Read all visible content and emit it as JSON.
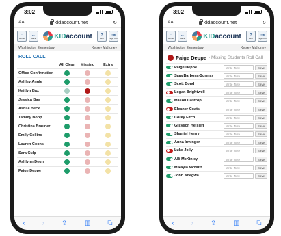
{
  "status": {
    "time": "3:02"
  },
  "browser": {
    "text_size": "AA",
    "url": "kidaccount.net"
  },
  "brand": {
    "kid": "KID",
    "account": "account"
  },
  "header": {
    "left_buttons": [
      {
        "icon": "home-icon",
        "label": "Home"
      },
      {
        "icon": "back-arrow-icon",
        "label": "Back"
      }
    ],
    "right_buttons": [
      {
        "icon": "help-icon",
        "label": "Help"
      },
      {
        "icon": "sign-out-icon",
        "label": "Sign Out"
      }
    ]
  },
  "school": "Washington Elementary",
  "user": "Kelsey Mahoney",
  "roll_call": {
    "title": "ROLL CALL",
    "columns": [
      "All Clear",
      "Missing",
      "Extra"
    ],
    "rows": [
      {
        "name": "Office Confirmation",
        "status": "clear"
      },
      {
        "name": "Ashley Angle",
        "status": "clear"
      },
      {
        "name": "Kaitlyn Bax",
        "status": "missing"
      },
      {
        "name": "Jessica Bax",
        "status": "clear"
      },
      {
        "name": "Ashlie Beck",
        "status": "clear"
      },
      {
        "name": "Tammy Bopp",
        "status": "clear"
      },
      {
        "name": "Christina Brauner",
        "status": "clear"
      },
      {
        "name": "Emily Collins",
        "status": "clear"
      },
      {
        "name": "Lauren Coons",
        "status": "clear"
      },
      {
        "name": "Sara Culp",
        "status": "clear"
      },
      {
        "name": "Ashlynn Degn",
        "status": "clear"
      },
      {
        "name": "Paige Deppe",
        "status": "clear"
      }
    ]
  },
  "missing": {
    "teacher": "Paige Deppe",
    "subtitle": "- Missing Students Roll Call",
    "note_placeholder": "Write Note",
    "save_label": "Save",
    "rows": [
      {
        "name": "Paige Deppe",
        "present": true
      },
      {
        "name": "Sara Barbosa-Surmay",
        "present": true
      },
      {
        "name": "Scott Bond",
        "present": true
      },
      {
        "name": "Logan Brightwell",
        "present": false
      },
      {
        "name": "Mason Castrop",
        "present": true
      },
      {
        "name": "Eleanor Coats",
        "present": false
      },
      {
        "name": "Corey Fitch",
        "present": true
      },
      {
        "name": "Grayson Heislen",
        "present": true
      },
      {
        "name": "Shaniel Henry",
        "present": true
      },
      {
        "name": "Anna Irminger",
        "present": true
      },
      {
        "name": "Luke Jolly",
        "present": false
      },
      {
        "name": "Alli McKinley",
        "present": true
      },
      {
        "name": "Mikayla McNutt",
        "present": true
      },
      {
        "name": "John Ndegwa",
        "present": true
      }
    ]
  }
}
